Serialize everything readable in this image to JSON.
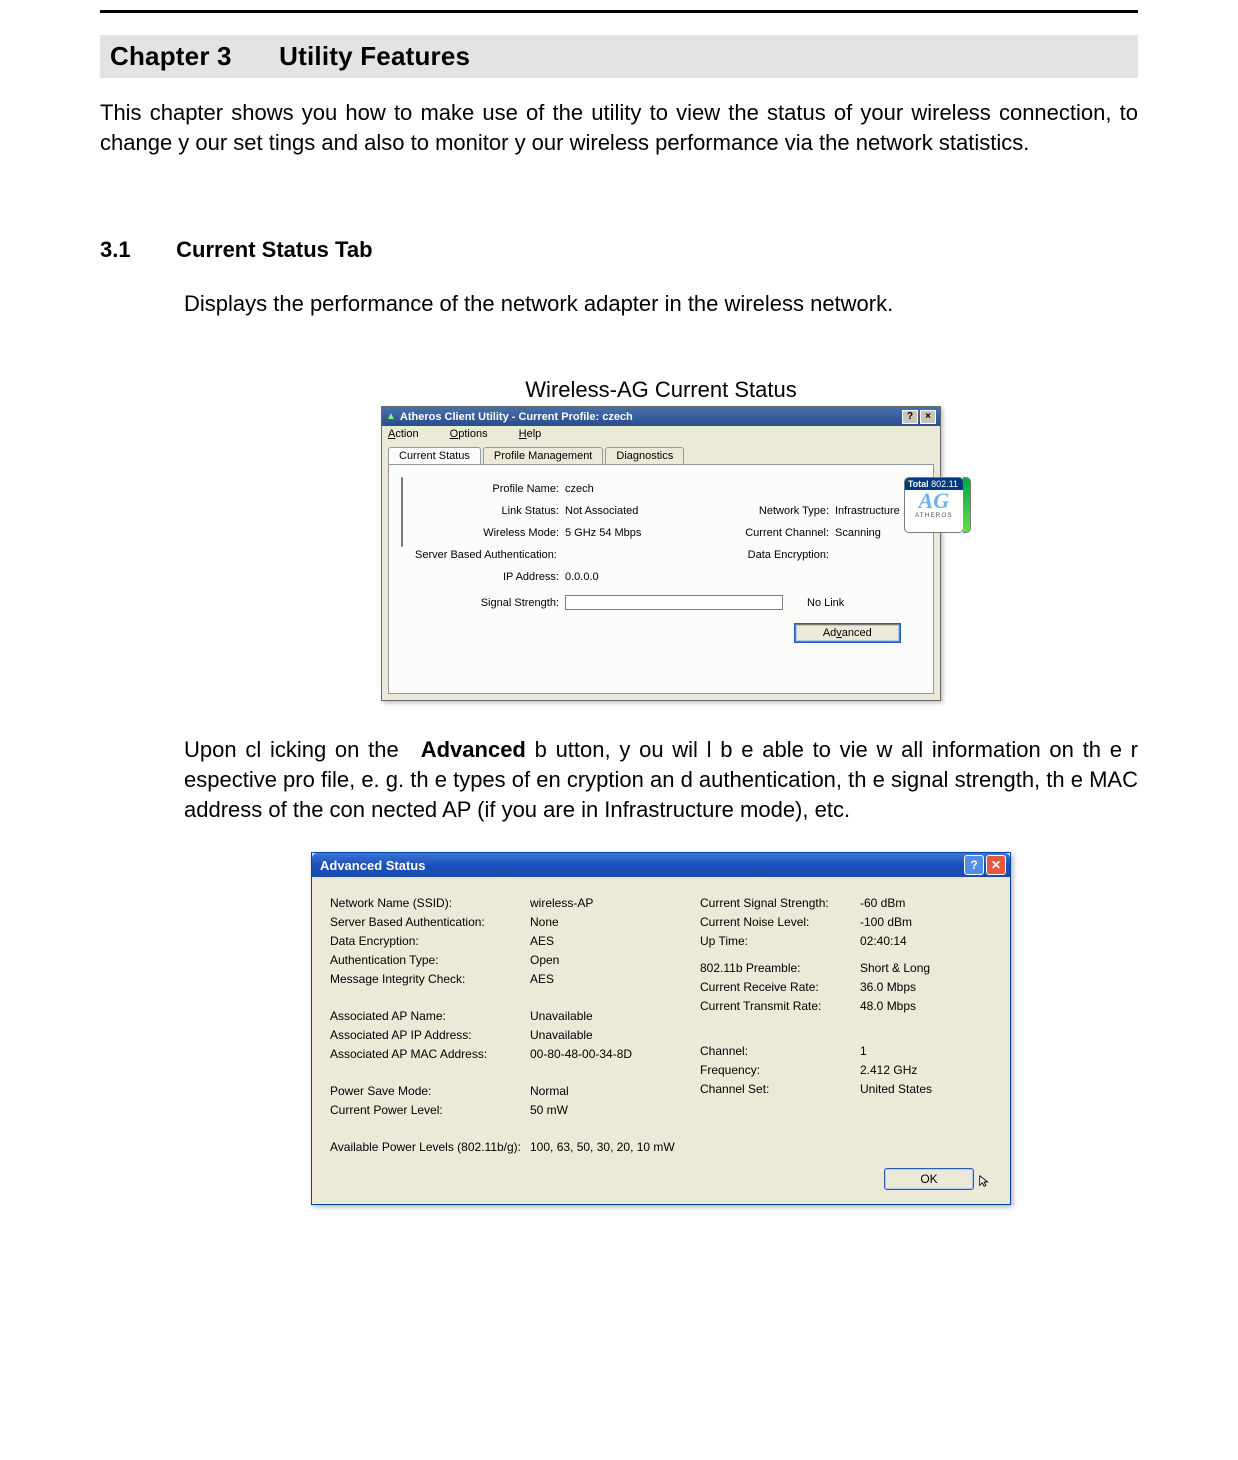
{
  "chapter": {
    "num": "Chapter 3",
    "title": "Utility Features"
  },
  "intro": "This chapter shows you how to  make use of the utility to view the status of your wireless connection, to  change y our set tings and also to monitor y our wireless performance via the network statistics.",
  "section": {
    "num": "3.1",
    "title": "Current Status Tab"
  },
  "sec_intro": "Displays the performance of the network adapter in the wireless network.",
  "fig1_caption": "Wireless-AG Current Status",
  "win1": {
    "title": "Atheros Client Utility - Current Profile: czech",
    "menu": {
      "action": "Action",
      "options": "Options",
      "help": "Help"
    },
    "tabs": {
      "current": "Current Status",
      "pm": "Profile Management",
      "diag": "Diagnostics"
    },
    "logo": {
      "top_text": "Total 802.11",
      "brand": "ATHEROS",
      "ag": "AG"
    },
    "labels": {
      "profile_name": "Profile Name:",
      "link_status": "Link Status:",
      "wireless_mode": "Wireless Mode:",
      "server_auth": "Server Based Authentication:",
      "ip_addr": "IP Address:",
      "signal_strength": "Signal Strength:",
      "network_type": "Network Type:",
      "current_channel": "Current Channel:",
      "data_encryption": "Data Encryption:"
    },
    "values": {
      "profile_name": "czech",
      "link_status": "Not Associated",
      "wireless_mode": "5 GHz 54 Mbps",
      "server_auth": "",
      "ip_addr": "0.0.0.0",
      "network_type": "Infrastructure",
      "current_channel": "Scanning",
      "data_encryption": "",
      "signal_text": "No Link"
    },
    "advanced_btn": "Advanced"
  },
  "para2_pre": "Upon cl icking on the ",
  "para2_bold": "Advanced",
  "para2_post": " b utton, y ou wil l b e  able to vie  w all information on  th e r espective pro file, e. g. th e types  of en  cryption an d authentication, th e signal  strength, th e  MAC address  of the con  nected AP (if you are in Infrastructure mode), etc.",
  "win2": {
    "title": "Advanced Status",
    "left_labels": {
      "ssid": "Network Name (SSID):",
      "sba": "Server Based Authentication:",
      "de": "Data Encryption:",
      "at": "Authentication Type:",
      "mic": "Message Integrity Check:",
      "aapn": "Associated AP Name:",
      "aapip": "Associated AP IP Address:",
      "aapmac": "Associated AP MAC Address:",
      "psm": "Power Save Mode:",
      "cpl": "Current Power Level:",
      "apl": "Available Power Levels (802.11b/g):"
    },
    "left_values": {
      "ssid": "wireless-AP",
      "sba": "None",
      "de": "AES",
      "at": "Open",
      "mic": "AES",
      "aapn": "Unavailable",
      "aapip": "Unavailable",
      "aapmac": "00-80-48-00-34-8D",
      "psm": "Normal",
      "cpl": "50 mW",
      "apl": "100, 63, 50, 30, 20, 10 mW"
    },
    "right_labels": {
      "css": "Current Signal Strength:",
      "cnl": "Current Noise Level:",
      "ut": "Up Time:",
      "pre": "802.11b Preamble:",
      "crr": "Current Receive Rate:",
      "ctr": "Current Transmit Rate:",
      "ch": "Channel:",
      "fr": "Frequency:",
      "cs": "Channel Set:"
    },
    "right_values": {
      "css": "-60 dBm",
      "cnl": "-100 dBm",
      "ut": "02:40:14",
      "pre": "Short & Long",
      "crr": "36.0 Mbps",
      "ctr": "48.0 Mbps",
      "ch": "1",
      "fr": "2.412 GHz",
      "cs": "United States"
    },
    "ok_btn": "OK"
  }
}
